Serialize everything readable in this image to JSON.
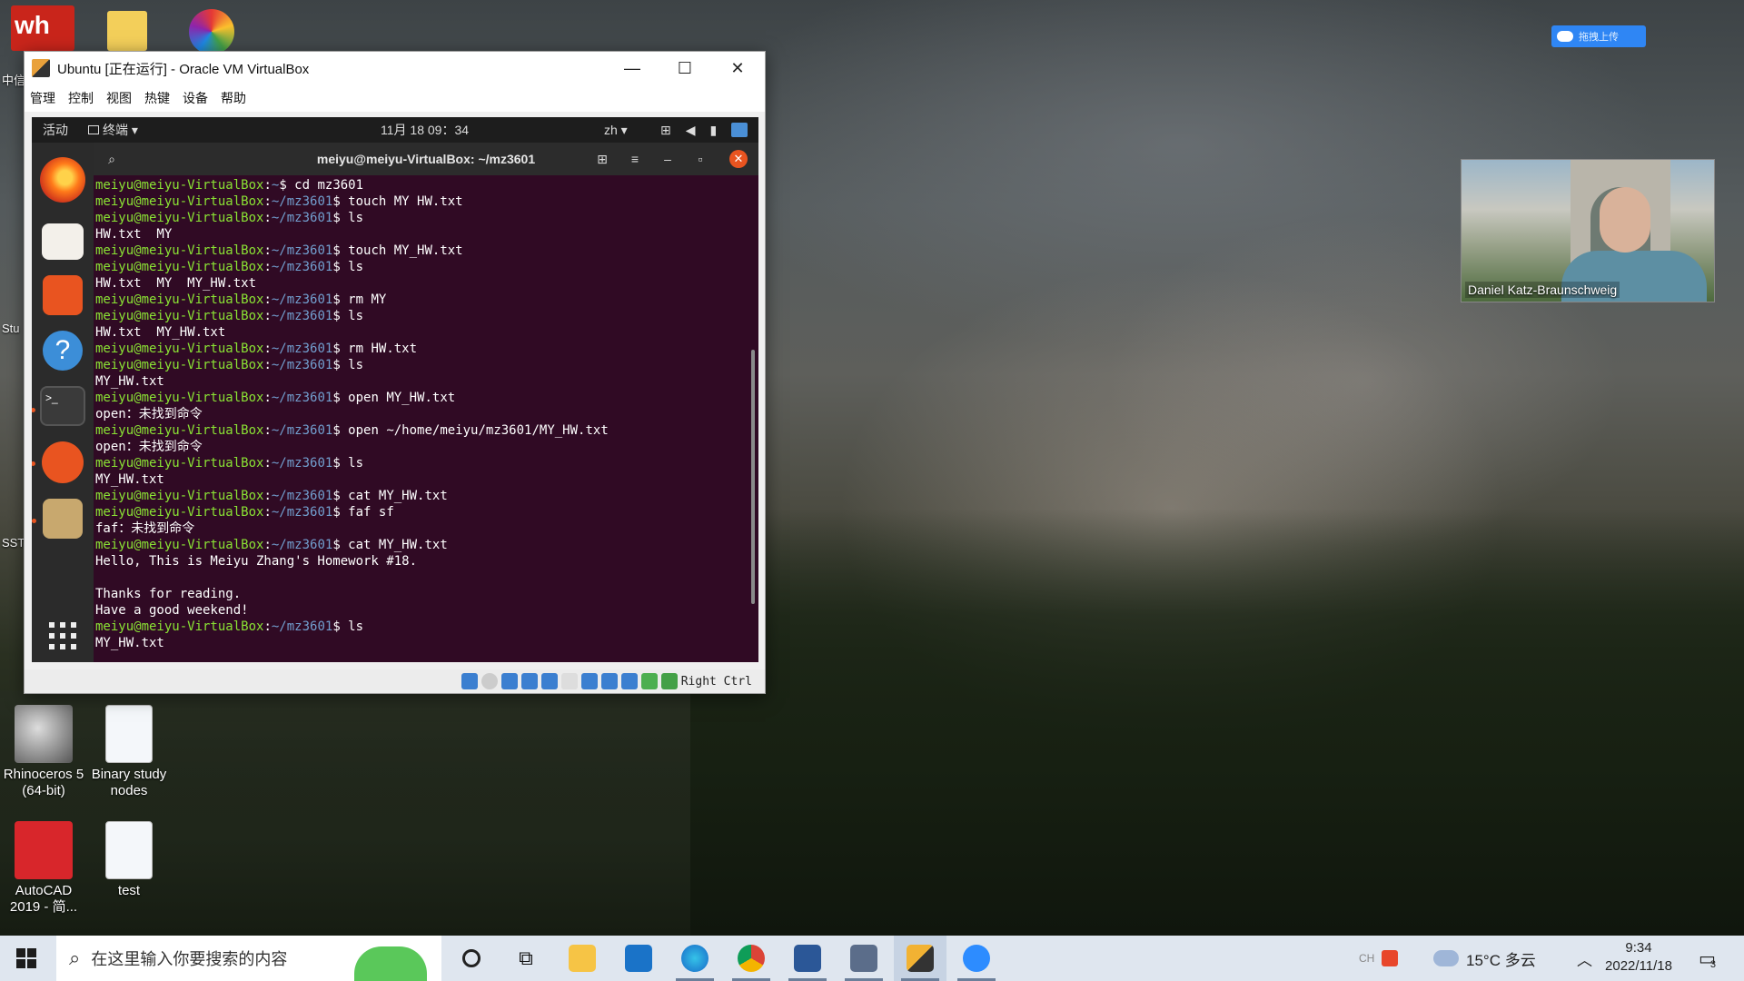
{
  "desktop": {
    "icons": [
      {
        "label": "Rhinoceros 5 (64-bit)",
        "color": "#6b6b6b"
      },
      {
        "label": "Binary study nodes",
        "color": "#f2f6fa"
      },
      {
        "label": "AutoCAD 2019 - 简...",
        "color": "#d8262b"
      },
      {
        "label": "test",
        "color": "#f2f6fa"
      }
    ],
    "partial_left_labels": [
      "中信",
      "Stu",
      "SST"
    ]
  },
  "baidu_button": {
    "label": "拖拽上传"
  },
  "video": {
    "participant": "Daniel Katz-Braunschweig"
  },
  "vbox": {
    "title": "Ubuntu [正在运行] - Oracle VM VirtualBox",
    "controls": {
      "minimize": "—",
      "maximize": "☐",
      "close": "✕"
    },
    "menu": [
      "管理",
      "控制",
      "视图",
      "热键",
      "设备",
      "帮助"
    ],
    "status_host_key": "Right Ctrl"
  },
  "gnome": {
    "activities": "活动",
    "terminal_menu": "终端 ▾",
    "clock": "11月 18  09：34",
    "input_lang": "zh ▾"
  },
  "terminal": {
    "title": "meiyu@meiyu-VirtualBox: ~/mz3601",
    "prompt_user": "meiyu@meiyu-VirtualBox",
    "lines": [
      {
        "path": "~",
        "cmd": "cd mz3601"
      },
      {
        "path": "~/mz3601",
        "cmd": "touch MY HW.txt"
      },
      {
        "path": "~/mz3601",
        "cmd": "ls"
      },
      {
        "out": "HW.txt  MY"
      },
      {
        "path": "~/mz3601",
        "cmd": "touch MY_HW.txt"
      },
      {
        "path": "~/mz3601",
        "cmd": "ls"
      },
      {
        "out": "HW.txt  MY  MY_HW.txt"
      },
      {
        "path": "~/mz3601",
        "cmd": "rm MY"
      },
      {
        "path": "~/mz3601",
        "cmd": "ls"
      },
      {
        "out": "HW.txt  MY_HW.txt"
      },
      {
        "path": "~/mz3601",
        "cmd": "rm HW.txt"
      },
      {
        "path": "~/mz3601",
        "cmd": "ls"
      },
      {
        "out": "MY_HW.txt"
      },
      {
        "path": "~/mz3601",
        "cmd": "open MY_HW.txt"
      },
      {
        "out": "open：未找到命令"
      },
      {
        "path": "~/mz3601",
        "cmd": "open ~/home/meiyu/mz3601/MY_HW.txt"
      },
      {
        "out": "open：未找到命令"
      },
      {
        "path": "~/mz3601",
        "cmd": "ls"
      },
      {
        "out": "MY_HW.txt"
      },
      {
        "path": "~/mz3601",
        "cmd": "cat MY_HW.txt"
      },
      {
        "path": "~/mz3601",
        "cmd": "faf sf"
      },
      {
        "out": "faf：未找到命令"
      },
      {
        "path": "~/mz3601",
        "cmd": "cat MY_HW.txt"
      },
      {
        "out": "Hello, This is Meiyu Zhang's Homework #18."
      },
      {
        "out": ""
      },
      {
        "out": "Thanks for reading."
      },
      {
        "out": "Have a good weekend!"
      },
      {
        "path": "~/mz3601",
        "cmd": "ls"
      },
      {
        "out": "MY_HW.txt"
      }
    ]
  },
  "taskbar": {
    "search_placeholder": "在这里输入你要搜索的内容",
    "weather": "15°C 多云",
    "ime": "CH",
    "time": "9:34",
    "date": "2022/11/18",
    "notifications": "3"
  }
}
